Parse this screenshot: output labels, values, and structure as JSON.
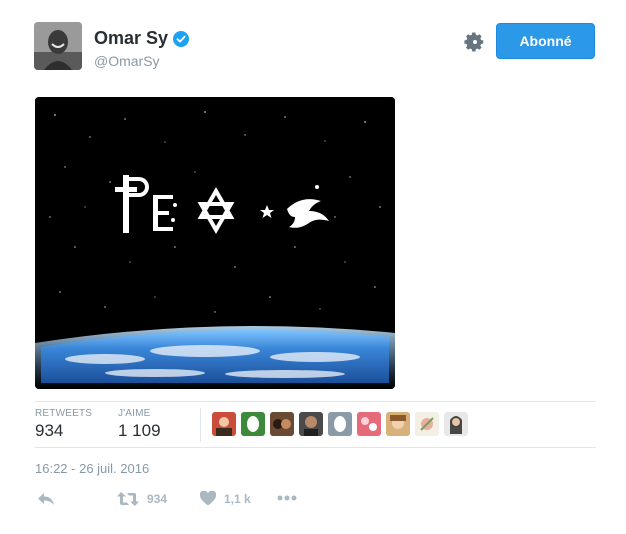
{
  "author": {
    "name": "Omar Sy",
    "handle": "@OmarSy",
    "verified": true
  },
  "follow_button": {
    "label": "Abonné"
  },
  "media": {
    "text": "PEACE"
  },
  "stats": {
    "retweets_label": "RETWEETS",
    "retweets_value": "934",
    "likes_label": "J'AIME",
    "likes_value": "1 109",
    "liker_avatars": [
      "liker-avatar",
      "liker-avatar",
      "liker-avatar",
      "liker-avatar",
      "liker-avatar",
      "liker-avatar",
      "liker-avatar",
      "liker-avatar",
      "liker-avatar"
    ]
  },
  "timestamp": "16:22 - 26 juil. 2016",
  "actions": {
    "retweet_count": "934",
    "like_count": "1,1 k"
  },
  "colors": {
    "brand_blue": "#2b98e8",
    "muted_text": "#8899a6",
    "icon_gray": "#aab8c2"
  },
  "icons": {
    "verified": "verified-badge-icon",
    "settings": "gear-icon",
    "reply": "reply-icon",
    "retweet": "retweet-icon",
    "like": "heart-icon",
    "more": "more-dots-icon"
  }
}
